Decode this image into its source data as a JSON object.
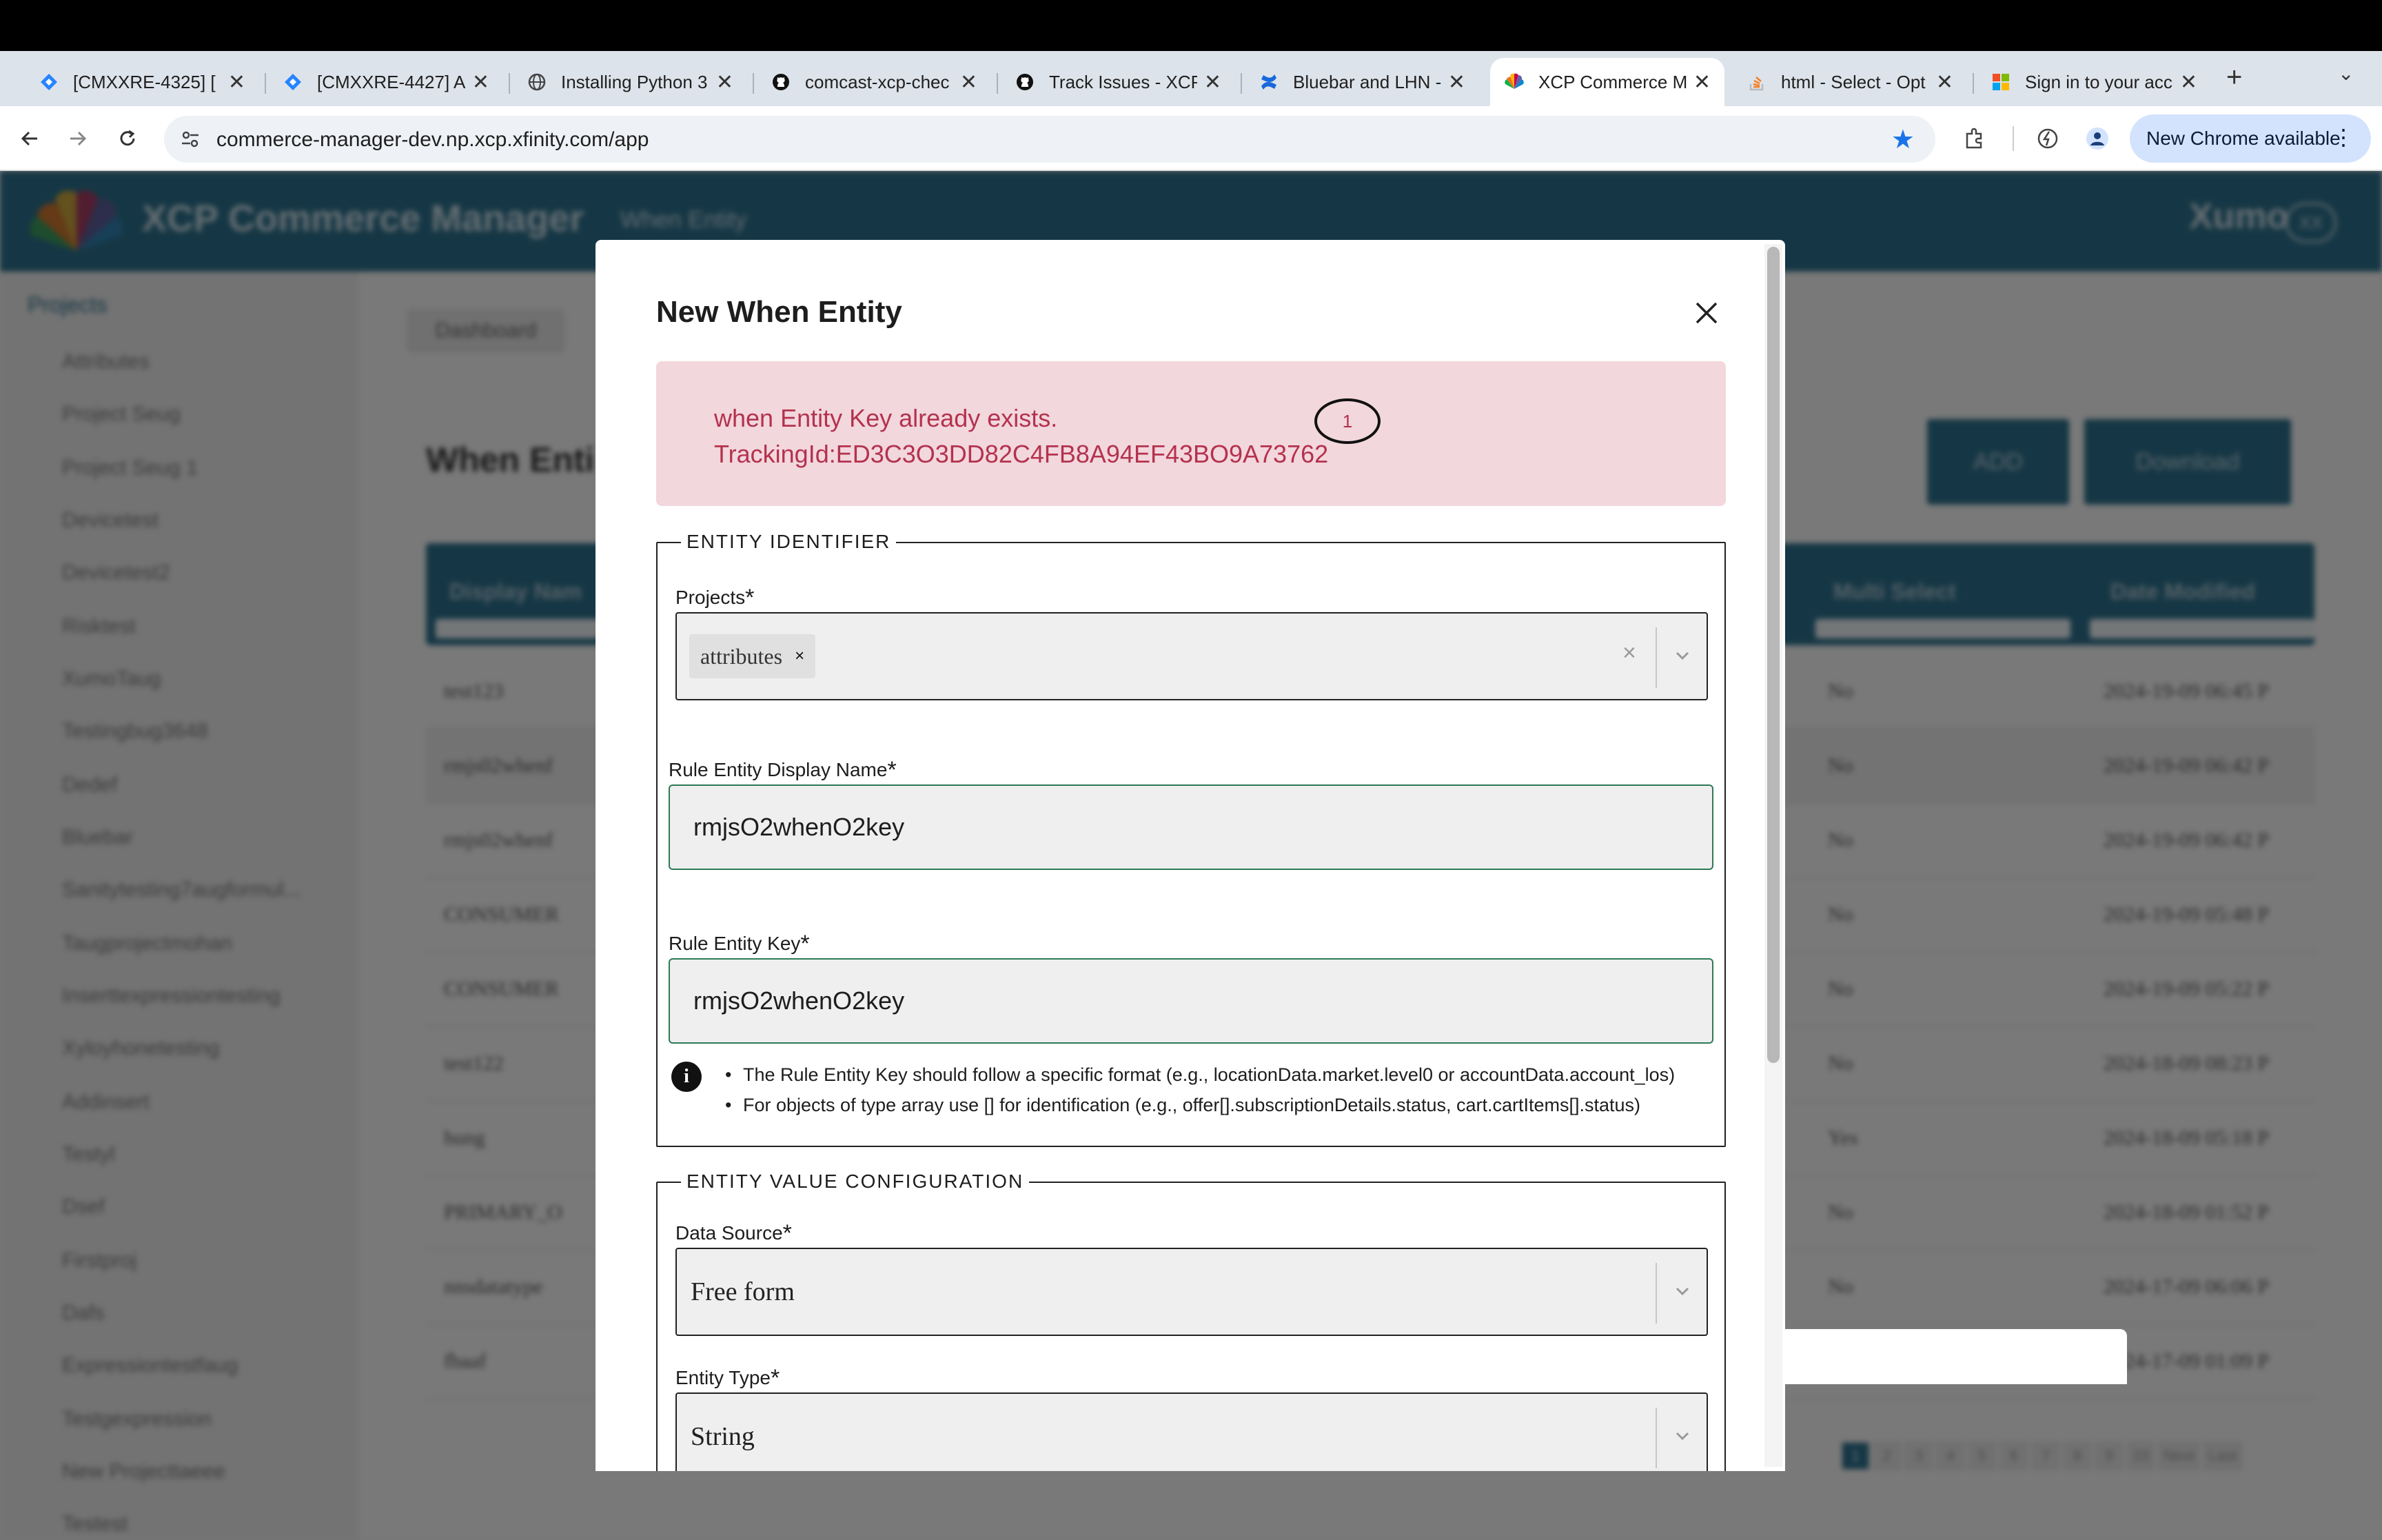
{
  "browser": {
    "tabs": [
      {
        "label": "[CMXXRE-4325] [",
        "icon": "jira-icon"
      },
      {
        "label": "[CMXXRE-4427] A",
        "icon": "jira-icon"
      },
      {
        "label": "Installing Python 3",
        "icon": "globe-icon"
      },
      {
        "label": "comcast-xcp-chec",
        "icon": "github-icon"
      },
      {
        "label": "Track Issues - XCP",
        "icon": "github-icon"
      },
      {
        "label": "Bluebar and LHN -",
        "icon": "confluence-icon"
      },
      {
        "label": "XCP Commerce M",
        "icon": "nbc-peacock-icon",
        "active": true
      },
      {
        "label": "html - Select - Opt",
        "icon": "stackoverflow-icon"
      },
      {
        "label": "Sign in to your acc",
        "icon": "microsoft-icon"
      }
    ],
    "tab_close_glyph": "✕",
    "new_tab_glyph": "+",
    "tab_search_glyph": "⌄",
    "url": "commerce-manager-dev.np.xcp.xfinity.com/app",
    "new_chrome_label": "New Chrome available",
    "colors": {
      "active_star": "#1a73e8",
      "update_pill": "#d3e3fd"
    }
  },
  "app": {
    "title": "XCP Commerce Manager",
    "header_crumb": "When Entity",
    "brand": "Xumo",
    "user_initials": "XX",
    "sidebar": {
      "heading": "Projects",
      "items": [
        "Attributes",
        "Project Seug",
        "Project Seug 1",
        "Devicetest",
        "Devicetest2",
        "Risktest",
        "XumoTaug",
        "Testingbug3648",
        "Dedef",
        "Bluebar",
        "Sanitytesting7augformul...",
        "Taugprojectmohan",
        "Inserttexpressiontesting",
        "Xyloyhonetesting",
        "Addinsert",
        "Testyl",
        "Dsef",
        "Firstproj",
        "Dafs",
        "Expressiontestfaug",
        "Testgexpression",
        "New Projecttaeee",
        "Testest"
      ]
    },
    "dashboard_label": "Dashboard",
    "page_heading": "When Enti",
    "add_label": "ADD",
    "download_label": "Download",
    "table": {
      "headers": [
        "Display Nam",
        "Multi Select",
        "Date Modified"
      ],
      "rows": [
        [
          "test123",
          "No",
          "2024-19-09 06:45 P"
        ],
        [
          "rmjs02whenf",
          "No",
          "2024-19-09 06:42 P"
        ],
        [
          "rmjs02whenf",
          "No",
          "2024-19-09 06:42 P"
        ],
        [
          "CONSUMER",
          "No",
          "2024-19-09 05:48 P"
        ],
        [
          "CONSUMER",
          "No",
          "2024-19-09 05:22 P"
        ],
        [
          "test122",
          "No",
          "2024-18-09 08:23 P"
        ],
        [
          "hung",
          "Yes",
          "2024-18-09 05:18 P"
        ],
        [
          "PRIMARY_O",
          "No",
          "2024-18-09 01:52 P"
        ],
        [
          "nnsdatatype",
          "No",
          "2024-17-09 06:06 P"
        ],
        [
          "fbaaf",
          "No",
          "2024-17-09 01:09 P"
        ]
      ]
    },
    "pager": [
      "1",
      "2",
      "3",
      "4",
      "5",
      "6",
      "7",
      "8",
      "9",
      "10",
      "Next",
      "Last"
    ],
    "accent_color": "#2b6e8a"
  },
  "modal": {
    "title": "New When Entity",
    "error": {
      "line1": "when Entity Key already exists.",
      "line2": "TrackingId:ED3C3O3DD82C4FB8A94EF43BO9A73762",
      "annotation": "1",
      "color": "#b4324d",
      "background": "#f2d7dd"
    },
    "identifier": {
      "legend": "ENTITY IDENTIFIER",
      "projects_label": "Projects",
      "projects_chip": "attributes",
      "chip_remove": "×",
      "clear_glyph": "×",
      "display_name_label": "Rule Entity Display Name",
      "display_name_value": "rmjsO2whenO2key",
      "key_label": "Rule Entity Key",
      "key_value": "rmjsO2whenO2key",
      "info_glyph": "i",
      "hints": [
        "The Rule Entity Key should follow a specific format (e.g., locationData.market.level0 or accountData.account_los)",
        "For objects of type array use [] for identification (e.g., offer[].subscriptionDetails.status, cart.cartItems[].status)"
      ]
    },
    "value_config": {
      "legend": "ENTITY VALUE CONFIGURATION",
      "data_source_label": "Data Source",
      "data_source_value": "Free form",
      "entity_type_label": "Entity Type",
      "entity_type_value": "String"
    },
    "required_mark": "*"
  }
}
